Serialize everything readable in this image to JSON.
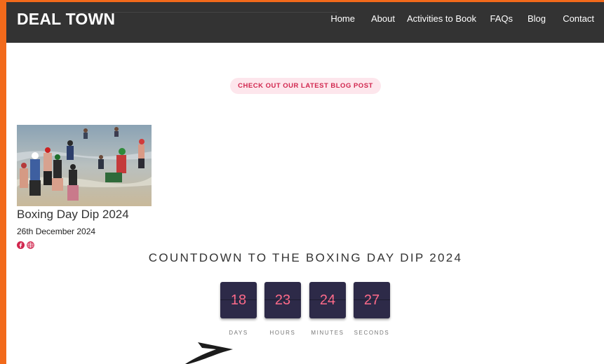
{
  "colors": {
    "accent": "#d1264e",
    "pill_bg": "#fde6ec",
    "frame": "#f26a1b",
    "header_bg": "#333333",
    "timer_bg": "#2d2a48",
    "timer_digit": "#ff6b8a"
  },
  "header": {
    "brand": "DEAL TOWN",
    "nav": [
      {
        "label": "Home"
      },
      {
        "label": "About"
      },
      {
        "label": "Activities to Book"
      },
      {
        "label": "FAQs"
      },
      {
        "label": "Blog"
      },
      {
        "label": "Contact"
      }
    ]
  },
  "blog_button": {
    "label": "CHECK OUT OUR LATEST BLOG POST"
  },
  "post": {
    "title": "Boxing Day Dip 2024",
    "date": "26th December 2024",
    "share_icons": [
      "facebook-icon",
      "globe-icon"
    ]
  },
  "countdown": {
    "title": "COUNTDOWN TO THE BOXING DAY DIP 2024",
    "units": [
      {
        "value": "18",
        "label": "DAYS"
      },
      {
        "value": "23",
        "label": "HOURS"
      },
      {
        "value": "24",
        "label": "MINUTES"
      },
      {
        "value": "27",
        "label": "SECONDS"
      }
    ]
  },
  "decor": {
    "arrow_icon": "arrow-icon"
  }
}
